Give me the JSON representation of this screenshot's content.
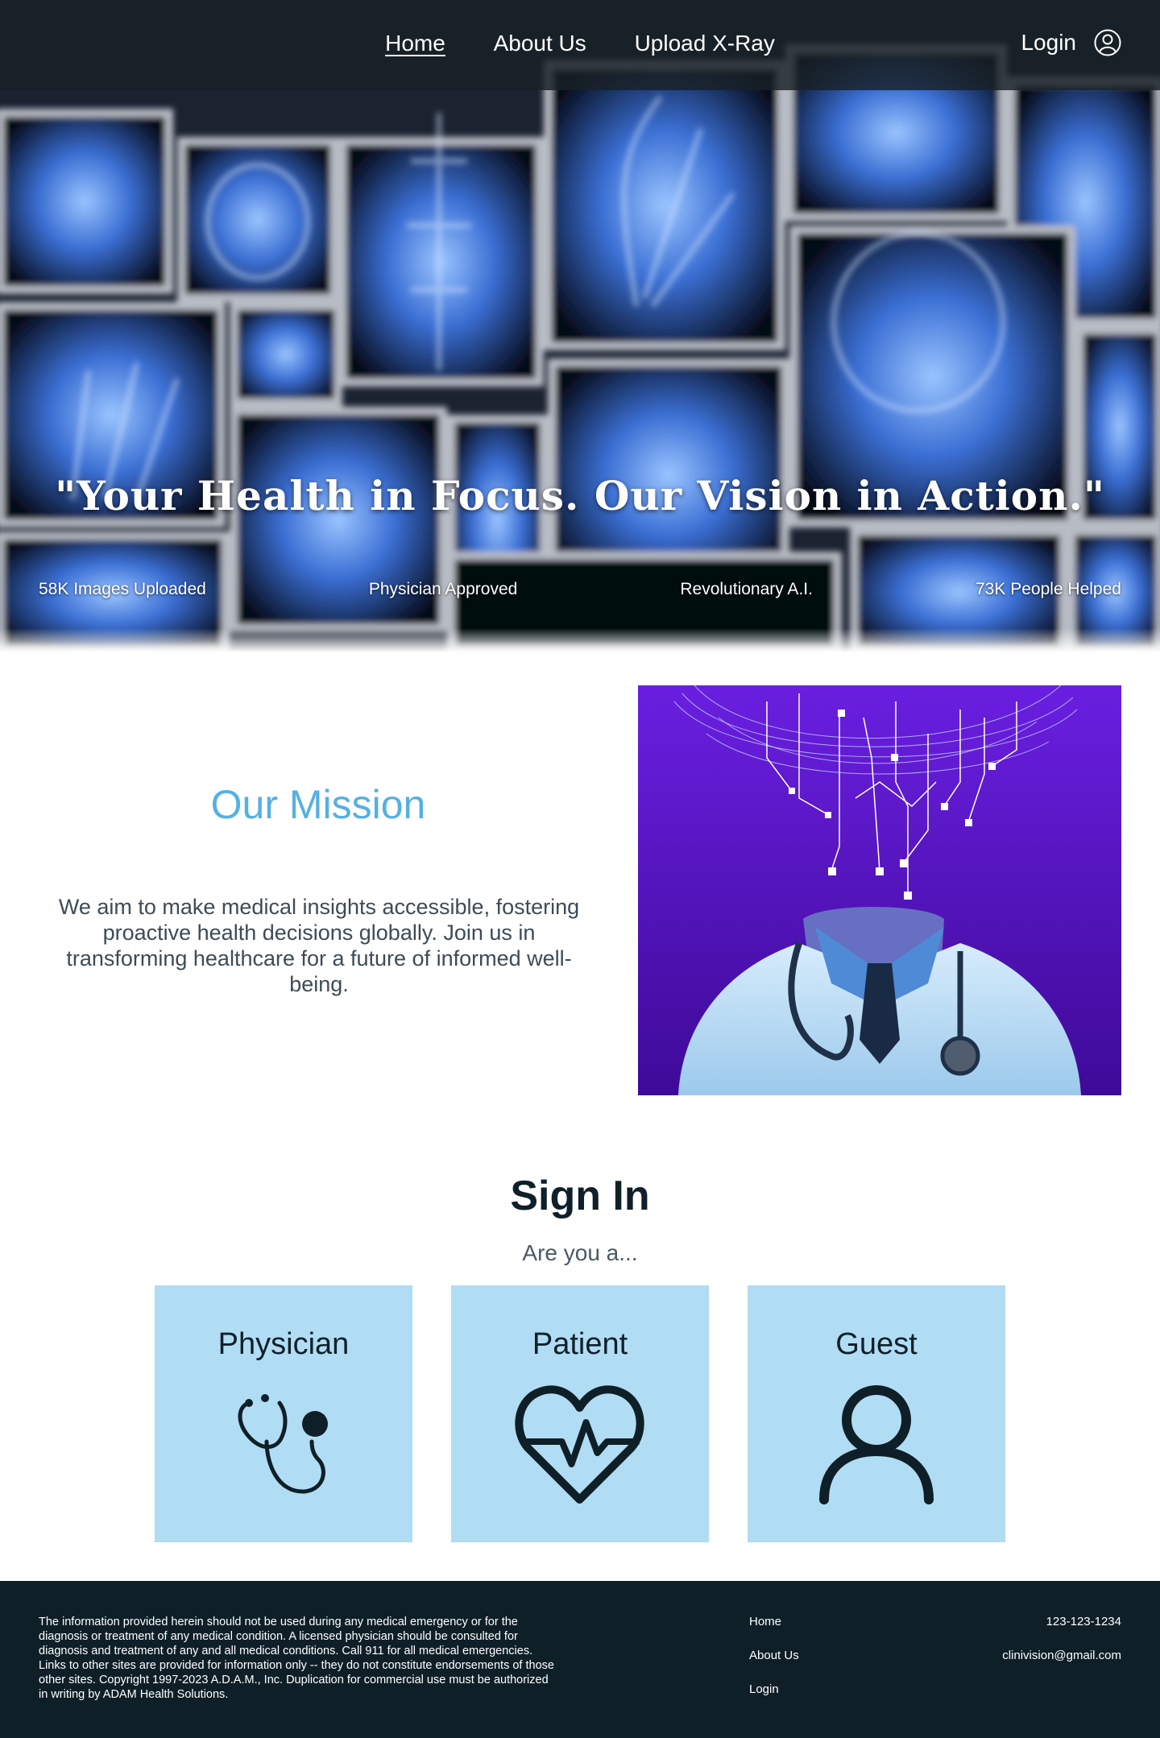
{
  "nav": {
    "links": [
      {
        "label": "Home",
        "active": true
      },
      {
        "label": "About Us",
        "active": false
      },
      {
        "label": "Upload X-Ray",
        "active": false
      }
    ],
    "login_label": "Login",
    "login_icon": "user-circle-icon"
  },
  "hero": {
    "quote": "\"Your Health in Focus. Our Vision in Action.\"",
    "stats": [
      "58K Images Uploaded",
      "Physician Approved",
      "Revolutionary A.I.",
      "73K People Helped"
    ]
  },
  "mission": {
    "title": "Our Mission",
    "body": "We aim to make medical insights accessible, fostering proactive health decisions globally. Join us in transforming healthcare for a future of informed well-being."
  },
  "signin": {
    "title": "Sign In",
    "subtitle": "Are you a...",
    "cards": [
      {
        "label": "Physician",
        "icon": "stethoscope-icon"
      },
      {
        "label": "Patient",
        "icon": "heart-pulse-icon"
      },
      {
        "label": "Guest",
        "icon": "user-icon"
      }
    ]
  },
  "footer": {
    "disclaimer": "The information provided herein should not be used during any medical emergency or for the diagnosis or treatment of any medical condition. A licensed physician should be consulted for diagnosis and treatment of any and all medical conditions. Call 911 for all medical emergencies. Links to other sites are provided for information only -- they do not constitute endorsements of those other sites. Copyright 1997-2023 A.D.A.M., Inc. Duplication for commercial use must be authorized in writing by ADAM Health Solutions.",
    "links": [
      "Home",
      "About Us",
      "Login"
    ],
    "phone": "123-123-1234",
    "email": "clinivision@gmail.com"
  },
  "colors": {
    "accent": "#55b0e3",
    "card_bg": "#b0ddf4",
    "footer_bg": "#0f1f28",
    "mission_img_bg": "#4a0fa8"
  }
}
